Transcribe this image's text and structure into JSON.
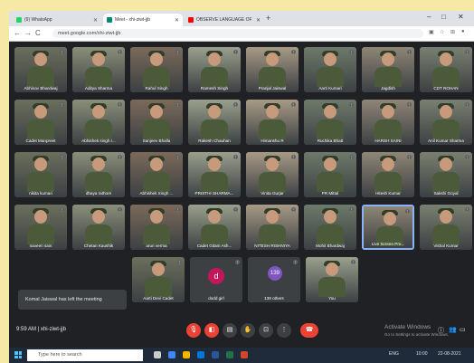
{
  "browser": {
    "tabs": [
      {
        "label": "(9) WhatsApp",
        "color": "#25d366",
        "active": false
      },
      {
        "label": "Meet - xhi-ziwt-jjb",
        "color": "#00897b",
        "active": true
      },
      {
        "label": "OBSERVE LANGUAGE OF IN...",
        "color": "#ff0000",
        "active": false
      }
    ],
    "new_tab": "+",
    "url": "meet.google.com/xhi-ziwt-jjb",
    "window_controls": [
      "–",
      "□",
      "✕"
    ]
  },
  "participants": [
    {
      "name": "Abhinav Bhardwaj"
    },
    {
      "name": "Aditya Sharma"
    },
    {
      "name": "Rahul Singh"
    },
    {
      "name": "Ramesh Singh"
    },
    {
      "name": "Pranjal Jaiswal"
    },
    {
      "name": "Aarti Kumari"
    },
    {
      "name": "Jagdish"
    },
    {
      "name": "CDT ROHAN"
    },
    {
      "name": "Cadet Manpreet"
    },
    {
      "name": "Abhishek singh r..."
    },
    {
      "name": "Sanjeev Bhalla"
    },
    {
      "name": "Rakesh Chauhan"
    },
    {
      "name": "Himanshu R"
    },
    {
      "name": "Ruchika Bhatt"
    },
    {
      "name": "HARSH SAINI"
    },
    {
      "name": "Anil Kumar Sharma"
    },
    {
      "name": "nikita kumari"
    },
    {
      "name": "dhaya rathore"
    },
    {
      "name": "Abhishek Singh ..."
    },
    {
      "name": "PRISTHI SHARMA..."
    },
    {
      "name": "Vinita Gurjar"
    },
    {
      "name": "PR Mittal"
    },
    {
      "name": "Hitesh Kumar"
    },
    {
      "name": "Sakshi Goyal"
    },
    {
      "name": "naveen sain"
    },
    {
      "name": "Chetan Kaushik"
    },
    {
      "name": "arun verma"
    },
    {
      "name": "Cadet Gitam Ash..."
    },
    {
      "name": "NITESH RISHNIYA"
    },
    {
      "name": "Mohit Bhardwaj"
    },
    {
      "name": "Live Screen Pre..."
    },
    {
      "name": "Vishal Kumar"
    },
    {
      "name": "Aarti Devi Cadet"
    },
    {
      "name": "dodd girl"
    },
    {
      "name": "139 others"
    },
    {
      "name": "You"
    }
  ],
  "others_count": "139",
  "avatar_letter": "d",
  "toast": "Komal Jaiswal has left the meeting",
  "meeting": {
    "time": "9:59 AM",
    "code": "xhi-ziwt-jjb",
    "separator": "|"
  },
  "controls": [
    {
      "icon": "mic-off-icon",
      "glyph": "🎙",
      "red": true
    },
    {
      "icon": "camera-off-icon",
      "glyph": "◧",
      "red": true
    },
    {
      "icon": "captions-icon",
      "glyph": "▤",
      "red": false
    },
    {
      "icon": "raise-hand-icon",
      "glyph": "✋",
      "red": false
    },
    {
      "icon": "present-icon",
      "glyph": "⊡",
      "red": false
    },
    {
      "icon": "more-options-icon",
      "glyph": "⋮",
      "red": false
    }
  ],
  "end_call_glyph": "☎",
  "activate": {
    "title": "Activate Windows",
    "sub": "Go to Settings to activate Windows."
  },
  "taskbar": {
    "search_placeholder": "Type here to search",
    "time": "10:00",
    "date": "22-08-2021",
    "lang": "ENG"
  }
}
